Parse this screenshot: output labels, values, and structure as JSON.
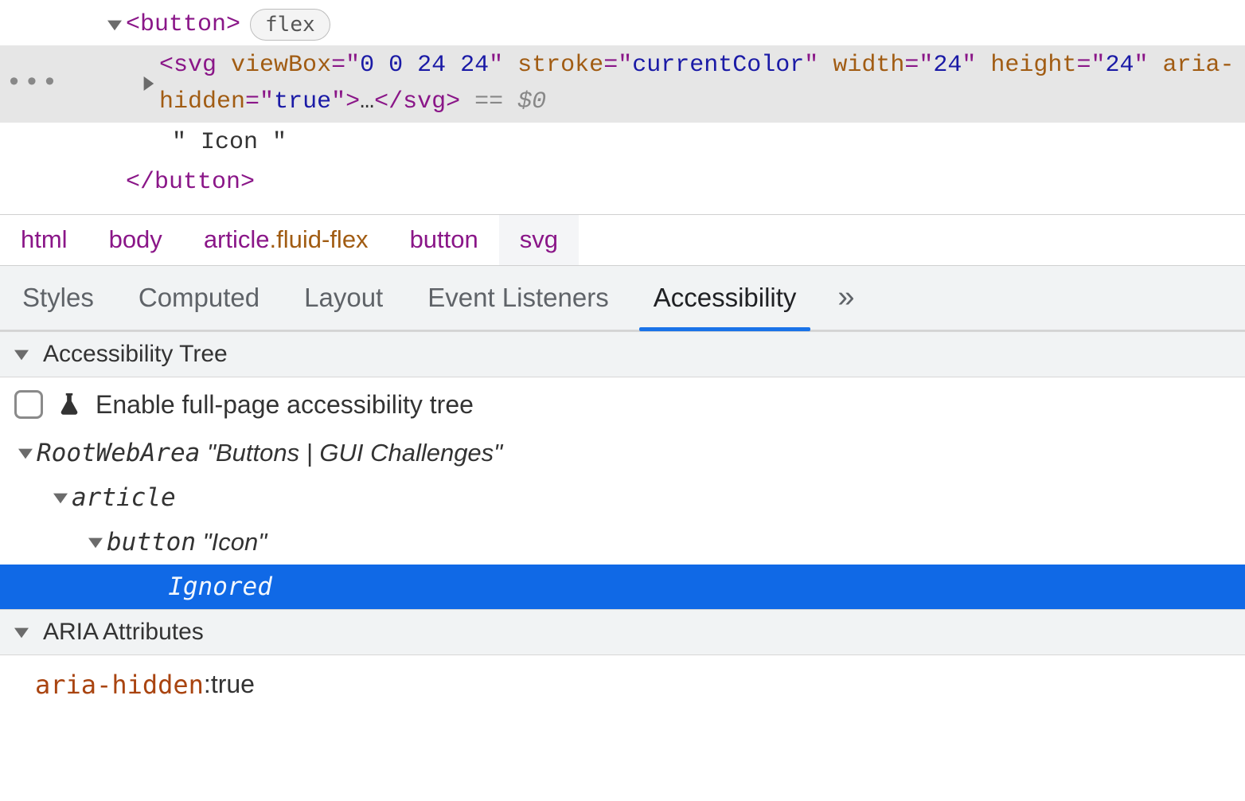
{
  "dom": {
    "button_open": "<button>",
    "button_close": "</button>",
    "flex_badge": "flex",
    "svg": {
      "tag_open_name": "svg",
      "attrs": {
        "viewBox_name": "viewBox",
        "viewBox_value": "0 0 24 24",
        "stroke_name": "stroke",
        "stroke_value": "currentColor",
        "width_name": "width",
        "width_value": "24",
        "height_name": "height",
        "height_value": "24",
        "aria_hidden_name": "aria-hidden",
        "aria_hidden_value": "true"
      },
      "collapsed": "…",
      "tag_close": "</svg>",
      "selected_ref": "== $0"
    },
    "text_node": "\" Icon \""
  },
  "breadcrumb": [
    {
      "tag": "html",
      "cls": ""
    },
    {
      "tag": "body",
      "cls": ""
    },
    {
      "tag": "article",
      "cls": ".fluid-flex"
    },
    {
      "tag": "button",
      "cls": ""
    },
    {
      "tag": "svg",
      "cls": ""
    }
  ],
  "panel_tabs": {
    "items": [
      "Styles",
      "Computed",
      "Layout",
      "Event Listeners",
      "Accessibility"
    ],
    "active_index": 4,
    "overflow_glyph": "»"
  },
  "a11y": {
    "section_tree_title": "Accessibility Tree",
    "enable_label": "Enable full-page accessibility tree",
    "tree": {
      "root_role": "RootWebArea",
      "root_name": "\"Buttons | GUI Challenges\"",
      "article_role": "article",
      "button_role": "button",
      "button_name": "\"Icon\"",
      "ignored_label": "Ignored"
    },
    "section_aria_title": "ARIA Attributes",
    "aria_attr": {
      "name": "aria-hidden",
      "value_sep": ": ",
      "value": "true"
    }
  }
}
